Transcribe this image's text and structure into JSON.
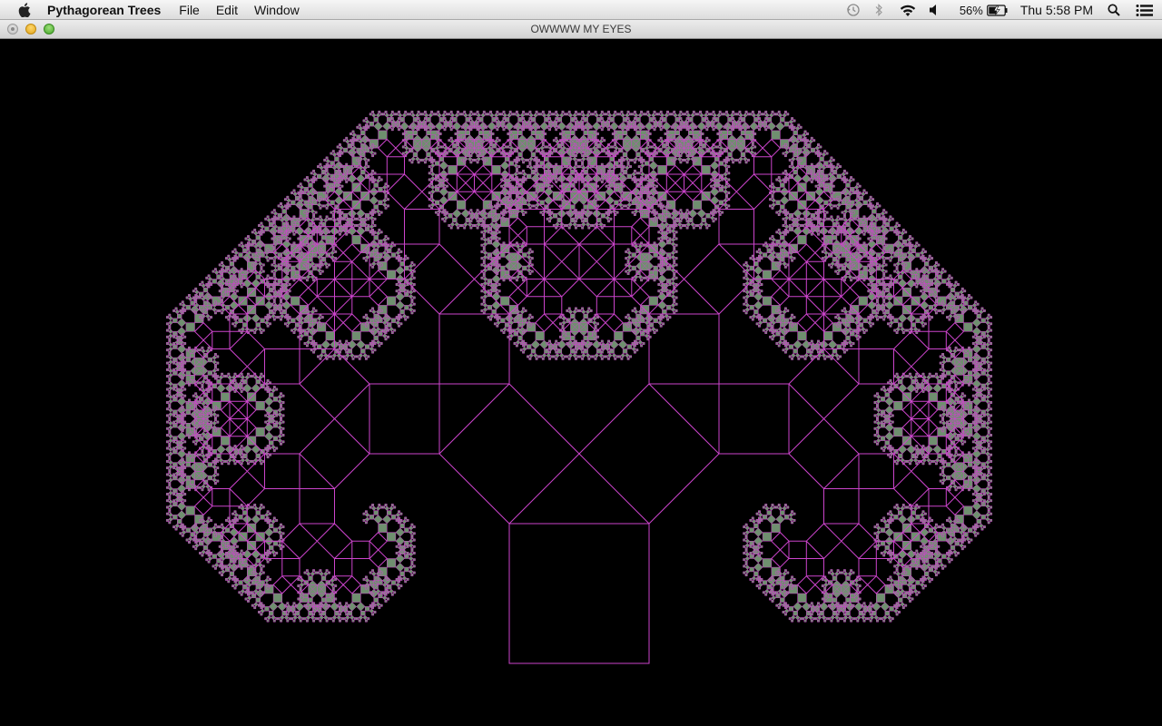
{
  "menubar": {
    "app_name": "Pythagorean Trees",
    "menus": [
      "File",
      "Edit",
      "Window"
    ],
    "battery": "56%",
    "clock": "Thu 5:58 PM"
  },
  "window": {
    "title": "OWWWW MY EYES"
  },
  "fractal": {
    "name": "Pythagorean tree",
    "line_color": "#cc44cc",
    "fill_color": "#6f8f6f",
    "background": "#000000"
  }
}
